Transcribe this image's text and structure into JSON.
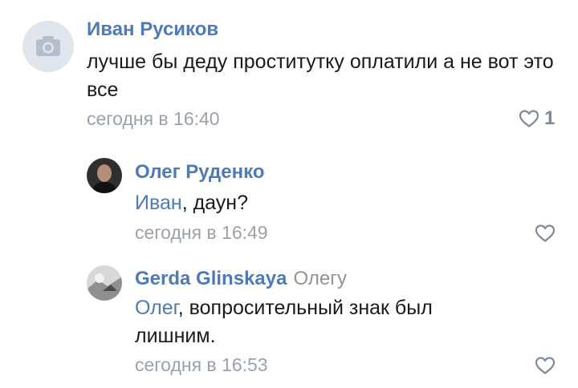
{
  "comments": [
    {
      "author": "Иван Русиков",
      "reply_to": "",
      "mention": "",
      "text_rest": "лучше бы деду проститутку оплатили а не вот это все",
      "time": "сегодня в 16:40",
      "likes": "1",
      "avatar_icon": "camera-icon"
    },
    {
      "author": "Олег Руденко",
      "reply_to": "",
      "mention": "Иван",
      "text_rest": ", даун?",
      "time": "сегодня в 16:49",
      "likes": ""
    },
    {
      "author": "Gerda Glinskaya",
      "reply_to": "Олегу",
      "mention": "Олег",
      "text_rest": ", вопросительный знак был лишним.",
      "time": "сегодня в 16:53",
      "likes": ""
    }
  ],
  "colors": {
    "link": "#4e7bb6",
    "meta": "#9aa1a8",
    "text": "#1a1a1a"
  }
}
